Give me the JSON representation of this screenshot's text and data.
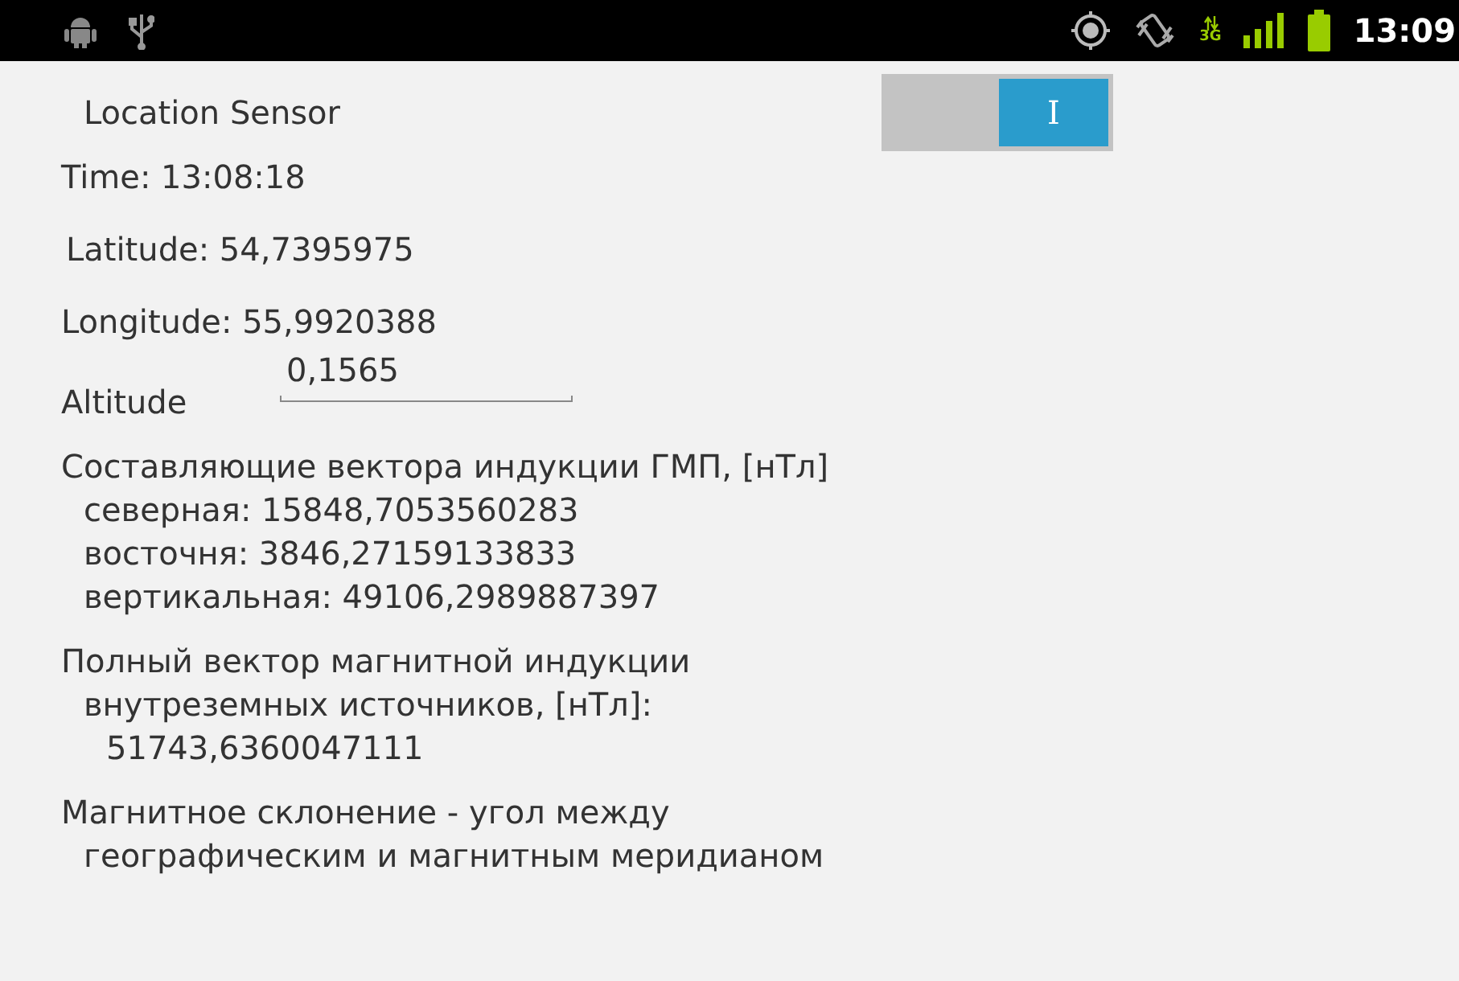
{
  "status_bar": {
    "network_label": "3G",
    "time": "13:09"
  },
  "title": "Location Sensor",
  "toggle": {
    "label": "I",
    "on": true
  },
  "readings": [
    "Time: 13:08:18",
    "Latitude: 54,7395975",
    "Longitude: 55,9920388"
  ],
  "altitude": {
    "label": "Altitude",
    "value": "0,1565"
  },
  "sections": [
    {
      "heading": "Составляющие вектора индукции ГМП, [нТл]",
      "lines": [
        {
          "text": "северная: 15848,7053560283"
        },
        {
          "text": "восточня: 3846,27159133833"
        },
        {
          "text": "вертикальная: 49106,2989887397"
        }
      ]
    },
    {
      "heading": "Полный вектор магнитной индукции",
      "lines": [
        {
          "text": "внутреземных источников, [нТл]:",
          "children": [
            {
              "text": "51743,6360047111"
            }
          ]
        }
      ]
    },
    {
      "heading": "Магнитное склонение - угол между",
      "lines": [
        {
          "text": "географическим и магнитным меридианом"
        }
      ]
    }
  ]
}
